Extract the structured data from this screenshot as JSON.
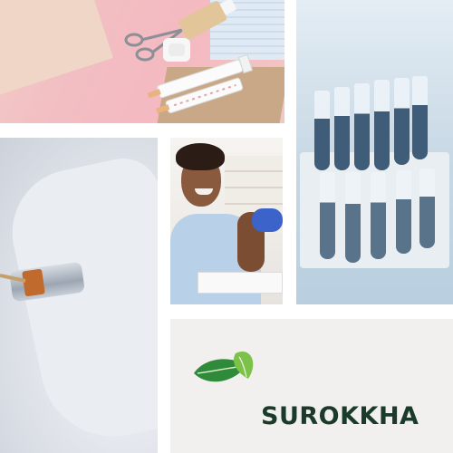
{
  "brand": {
    "name": "SUROKKHA",
    "icon": "leaf-logo-icon",
    "colors": {
      "wordmark": "#1a3a2a",
      "leaf_dark": "#2f8a3a",
      "leaf_light": "#7cc24a"
    }
  },
  "photos": {
    "flat_lay": {
      "icon": "medical-supplies-photo"
    },
    "test_tubes": {
      "icon": "test-tubes-photo"
    },
    "injection": {
      "icon": "syringe-vial-photo"
    },
    "patient": {
      "icon": "vaccinated-patient-photo"
    }
  },
  "colors": {
    "background": "#ffffff",
    "logo_panel": "#f1f0ee",
    "pink": "#f2bfc3"
  }
}
